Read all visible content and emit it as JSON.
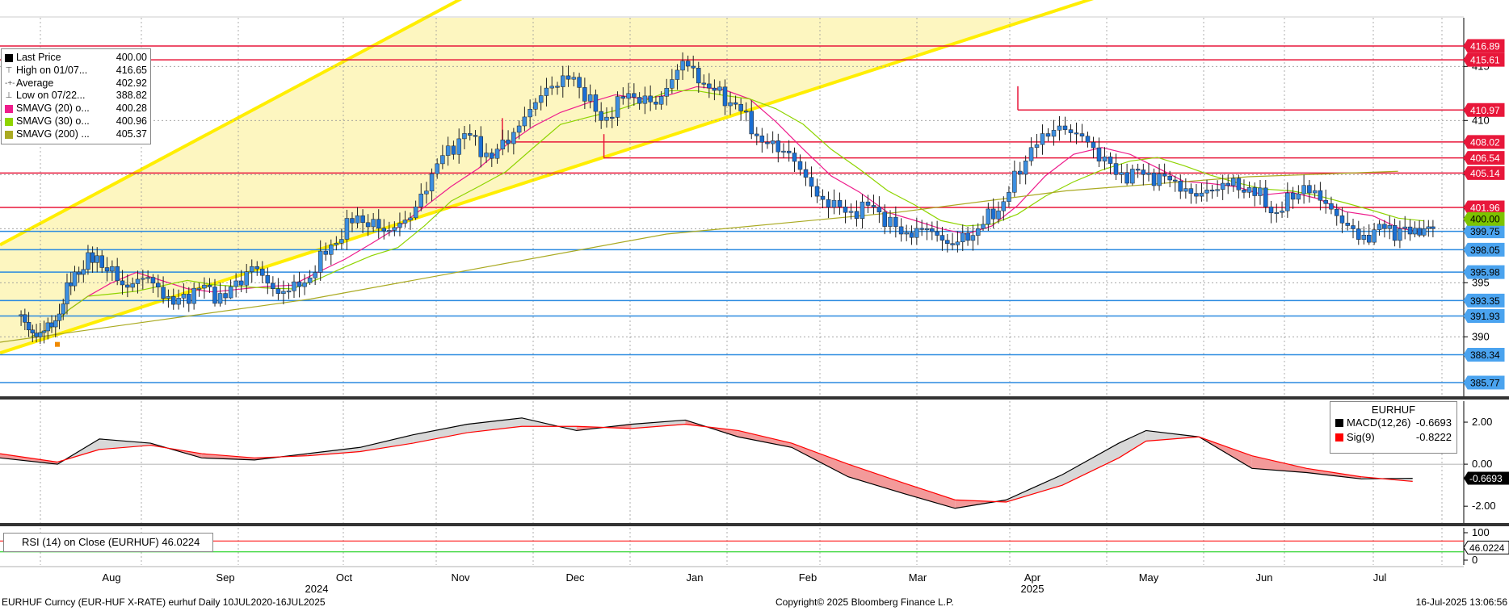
{
  "chart_data": {
    "type": "candlestick",
    "instrument": "EURHUF Curncy (EUR-HUF X-RATE) eurhuf",
    "period": "Daily 10JUL2020-16JUL2025",
    "months": [
      "Aug",
      "Sep",
      "Oct",
      "Nov",
      "Dec",
      "Jan",
      "Feb",
      "Mar",
      "Apr",
      "May",
      "Jun",
      "Jul"
    ],
    "years": [
      "2024",
      "2025"
    ],
    "price_ticks": [
      "415",
      "410",
      "405",
      "400",
      "395",
      "390"
    ],
    "ylim": [
      384.5,
      419.5
    ],
    "legend": {
      "items": [
        {
          "label": "Last Price",
          "value": "400.00",
          "color": "#000000",
          "icon": "square-swatch"
        },
        {
          "label": "High on 01/07...",
          "value": "416.65",
          "icon": "high-marker-icon"
        },
        {
          "label": "Average",
          "value": "402.92",
          "icon": "average-marker-icon"
        },
        {
          "label": "Low on 07/22...",
          "value": "388.82",
          "icon": "low-marker-icon"
        },
        {
          "label": "SMAVG (20)  o...",
          "value": "400.28",
          "color": "#ee1d8c"
        },
        {
          "label": "SMAVG (30)  o...",
          "value": "400.96",
          "color": "#8fd400"
        },
        {
          "label": "SMAVG (200)  ...",
          "value": "405.37",
          "color": "#aaaa22"
        }
      ]
    },
    "resistance_levels": [
      {
        "label": "416.89",
        "value": 416.89
      },
      {
        "label": "415.61",
        "value": 415.61
      },
      {
        "label": "410.97",
        "value": 410.97,
        "start_month": "Apr"
      },
      {
        "label": "408.02",
        "value": 408.02,
        "start_month": "Dec"
      },
      {
        "label": "406.54",
        "value": 406.54,
        "start_month": "Dec"
      },
      {
        "label": "405.14",
        "value": 405.14
      },
      {
        "label": "401.96",
        "value": 401.96
      }
    ],
    "support_levels": [
      {
        "label": "399.75",
        "value": 399.75
      },
      {
        "label": "398.05",
        "value": 398.05
      },
      {
        "label": "395.98",
        "value": 395.98
      },
      {
        "label": "393.35",
        "value": 393.35
      },
      {
        "label": "391.93",
        "value": 391.93
      },
      {
        "label": "388.34",
        "value": 388.34
      },
      {
        "label": "385.77",
        "value": 385.77
      }
    ],
    "last_price_tag": "400.00",
    "trend_channel": {
      "color": "#ffee00",
      "upper": [
        [
          "2024-07-01",
          398.5
        ],
        [
          "2024-12-30",
          431
        ]
      ],
      "lower": [
        [
          "2024-07-01",
          388.5
        ],
        [
          "2025-05-15",
          424
        ]
      ]
    },
    "candles_weekly_approx": [
      {
        "x": "2024-07-08",
        "o": 392.0,
        "h": 392.6,
        "l": 389.5,
        "c": 390.0
      },
      {
        "x": "2024-07-15",
        "o": 390.0,
        "h": 392.0,
        "l": 388.8,
        "c": 391.5
      },
      {
        "x": "2024-07-22",
        "o": 391.5,
        "h": 396.8,
        "l": 388.8,
        "c": 396.0
      },
      {
        "x": "2024-07-29",
        "o": 396.0,
        "h": 398.5,
        "l": 395.0,
        "c": 397.5
      },
      {
        "x": "2024-08-05",
        "o": 397.5,
        "h": 398.0,
        "l": 393.8,
        "c": 394.8
      },
      {
        "x": "2024-08-12",
        "o": 394.8,
        "h": 396.2,
        "l": 393.0,
        "c": 395.5
      },
      {
        "x": "2024-08-19",
        "o": 395.5,
        "h": 395.8,
        "l": 392.5,
        "c": 393.0
      },
      {
        "x": "2024-08-26",
        "o": 393.0,
        "h": 395.0,
        "l": 392.3,
        "c": 394.5
      },
      {
        "x": "2024-09-02",
        "o": 394.5,
        "h": 395.5,
        "l": 392.8,
        "c": 393.6
      },
      {
        "x": "2024-09-09",
        "o": 393.6,
        "h": 397.4,
        "l": 393.5,
        "c": 396.5
      },
      {
        "x": "2024-09-16",
        "o": 396.5,
        "h": 397.0,
        "l": 393.4,
        "c": 394.0
      },
      {
        "x": "2024-09-23",
        "o": 394.0,
        "h": 396.0,
        "l": 393.0,
        "c": 395.0
      },
      {
        "x": "2024-09-30",
        "o": 395.0,
        "h": 399.0,
        "l": 394.8,
        "c": 398.5
      },
      {
        "x": "2024-10-07",
        "o": 398.5,
        "h": 402.0,
        "l": 398.0,
        "c": 401.2
      },
      {
        "x": "2024-10-14",
        "o": 401.2,
        "h": 401.8,
        "l": 399.0,
        "c": 399.8
      },
      {
        "x": "2024-10-21",
        "o": 399.8,
        "h": 402.0,
        "l": 399.3,
        "c": 401.0
      },
      {
        "x": "2024-10-28",
        "o": 401.0,
        "h": 406.5,
        "l": 400.8,
        "c": 406.0
      },
      {
        "x": "2024-11-04",
        "o": 406.0,
        "h": 409.5,
        "l": 405.5,
        "c": 408.8
      },
      {
        "x": "2024-11-11",
        "o": 408.8,
        "h": 411.0,
        "l": 404.5,
        "c": 406.5
      },
      {
        "x": "2024-11-18",
        "o": 406.5,
        "h": 410.0,
        "l": 406.0,
        "c": 409.5
      },
      {
        "x": "2024-11-25",
        "o": 409.5,
        "h": 414.0,
        "l": 409.0,
        "c": 413.0
      },
      {
        "x": "2024-12-02",
        "o": 413.0,
        "h": 415.5,
        "l": 412.0,
        "c": 414.0
      },
      {
        "x": "2024-12-09",
        "o": 414.0,
        "h": 414.5,
        "l": 409.0,
        "c": 410.0
      },
      {
        "x": "2024-12-16",
        "o": 410.0,
        "h": 413.5,
        "l": 408.5,
        "c": 412.5
      },
      {
        "x": "2024-12-23",
        "o": 412.5,
        "h": 416.5,
        "l": 410.5,
        "c": 411.5
      },
      {
        "x": "2024-12-30",
        "o": 411.5,
        "h": 416.65,
        "l": 411.0,
        "c": 415.5
      },
      {
        "x": "2025-01-06",
        "o": 415.5,
        "h": 416.0,
        "l": 412.0,
        "c": 413.0
      },
      {
        "x": "2025-01-13",
        "o": 413.0,
        "h": 413.8,
        "l": 410.5,
        "c": 411.5
      },
      {
        "x": "2025-01-20",
        "o": 411.5,
        "h": 412.5,
        "l": 407.0,
        "c": 408.0
      },
      {
        "x": "2025-01-27",
        "o": 408.0,
        "h": 409.0,
        "l": 405.5,
        "c": 407.0
      },
      {
        "x": "2025-02-03",
        "o": 407.0,
        "h": 407.5,
        "l": 402.0,
        "c": 403.0
      },
      {
        "x": "2025-02-10",
        "o": 403.0,
        "h": 404.0,
        "l": 400.5,
        "c": 401.5
      },
      {
        "x": "2025-02-17",
        "o": 401.5,
        "h": 405.5,
        "l": 400.0,
        "c": 402.0
      },
      {
        "x": "2025-02-24",
        "o": 402.0,
        "h": 403.0,
        "l": 398.8,
        "c": 399.5
      },
      {
        "x": "2025-03-03",
        "o": 399.5,
        "h": 401.5,
        "l": 398.5,
        "c": 400.0
      },
      {
        "x": "2025-03-10",
        "o": 400.0,
        "h": 401.0,
        "l": 397.8,
        "c": 398.5
      },
      {
        "x": "2025-03-17",
        "o": 398.5,
        "h": 400.5,
        "l": 397.8,
        "c": 400.0
      },
      {
        "x": "2025-03-24",
        "o": 400.0,
        "h": 403.0,
        "l": 399.8,
        "c": 402.5
      },
      {
        "x": "2025-03-31",
        "o": 402.5,
        "h": 408.5,
        "l": 402.0,
        "c": 407.5
      },
      {
        "x": "2025-04-07",
        "o": 407.5,
        "h": 411.0,
        "l": 403.5,
        "c": 409.5
      },
      {
        "x": "2025-04-14",
        "o": 409.5,
        "h": 410.5,
        "l": 407.5,
        "c": 408.0
      },
      {
        "x": "2025-04-21",
        "o": 408.0,
        "h": 409.0,
        "l": 404.5,
        "c": 405.0
      },
      {
        "x": "2025-04-28",
        "o": 405.0,
        "h": 406.0,
        "l": 404.0,
        "c": 405.0
      },
      {
        "x": "2025-05-05",
        "o": 405.0,
        "h": 406.5,
        "l": 403.5,
        "c": 404.5
      },
      {
        "x": "2025-05-12",
        "o": 404.5,
        "h": 405.0,
        "l": 402.3,
        "c": 403.0
      },
      {
        "x": "2025-05-19",
        "o": 403.0,
        "h": 405.0,
        "l": 402.5,
        "c": 404.2
      },
      {
        "x": "2025-05-26",
        "o": 404.2,
        "h": 405.0,
        "l": 402.8,
        "c": 403.8
      },
      {
        "x": "2025-06-02",
        "o": 403.8,
        "h": 404.5,
        "l": 400.5,
        "c": 401.5
      },
      {
        "x": "2025-06-09",
        "o": 401.5,
        "h": 405.0,
        "l": 401.0,
        "c": 404.0
      },
      {
        "x": "2025-06-16",
        "o": 404.0,
        "h": 404.5,
        "l": 401.0,
        "c": 401.8
      },
      {
        "x": "2025-06-23",
        "o": 401.8,
        "h": 402.3,
        "l": 398.5,
        "c": 399.0
      },
      {
        "x": "2025-06-30",
        "o": 399.0,
        "h": 400.8,
        "l": 398.5,
        "c": 400.0
      },
      {
        "x": "2025-07-07",
        "o": 400.0,
        "h": 401.2,
        "l": 398.2,
        "c": 399.5
      },
      {
        "x": "2025-07-14",
        "o": 399.5,
        "h": 400.8,
        "l": 399.2,
        "c": 400.0
      }
    ],
    "macd": {
      "label": "MACD(12,26)",
      "value": "-0.6693",
      "color": "#000000",
      "signal_label": "Sig(9)",
      "signal_value": "-0.8222",
      "signal_color": "#ff0000",
      "panel_title": "EURHUF",
      "ticks": [
        "2.00",
        "0.00",
        "-2.00"
      ],
      "last_tag": "-0.6693",
      "ylim": [
        -2.8,
        3.0
      ],
      "points": [
        [
          "2024-07-01",
          0.3
        ],
        [
          "2024-07-22",
          0.0
        ],
        [
          "2024-08-05",
          1.2
        ],
        [
          "2024-08-19",
          1.0
        ],
        [
          "2024-09-02",
          0.3
        ],
        [
          "2024-09-16",
          0.2
        ],
        [
          "2024-09-30",
          0.5
        ],
        [
          "2024-10-14",
          0.8
        ],
        [
          "2024-10-28",
          1.4
        ],
        [
          "2024-11-11",
          1.9
        ],
        [
          "2024-11-25",
          2.2
        ],
        [
          "2024-12-09",
          1.6
        ],
        [
          "2024-12-23",
          1.9
        ],
        [
          "2025-01-06",
          2.1
        ],
        [
          "2025-01-20",
          1.3
        ],
        [
          "2025-02-03",
          0.8
        ],
        [
          "2025-02-17",
          -0.6
        ],
        [
          "2025-03-03",
          -1.4
        ],
        [
          "2025-03-17",
          -2.1
        ],
        [
          "2025-03-31",
          -1.7
        ],
        [
          "2025-04-14",
          -0.5
        ],
        [
          "2025-04-28",
          1.0
        ],
        [
          "2025-05-05",
          1.6
        ],
        [
          "2025-05-19",
          1.3
        ],
        [
          "2025-06-02",
          -0.2
        ],
        [
          "2025-06-16",
          -0.4
        ],
        [
          "2025-06-30",
          -0.7
        ],
        [
          "2025-07-14",
          -0.67
        ]
      ],
      "signal": [
        [
          "2024-07-01",
          0.5
        ],
        [
          "2024-07-22",
          0.1
        ],
        [
          "2024-08-05",
          0.7
        ],
        [
          "2024-08-19",
          0.9
        ],
        [
          "2024-09-02",
          0.5
        ],
        [
          "2024-09-16",
          0.3
        ],
        [
          "2024-09-30",
          0.4
        ],
        [
          "2024-10-14",
          0.6
        ],
        [
          "2024-10-28",
          1.0
        ],
        [
          "2024-11-11",
          1.5
        ],
        [
          "2024-11-25",
          1.8
        ],
        [
          "2024-12-09",
          1.8
        ],
        [
          "2024-12-23",
          1.7
        ],
        [
          "2025-01-06",
          1.9
        ],
        [
          "2025-01-20",
          1.6
        ],
        [
          "2025-02-03",
          1.0
        ],
        [
          "2025-02-17",
          0.0
        ],
        [
          "2025-03-03",
          -0.9
        ],
        [
          "2025-03-17",
          -1.7
        ],
        [
          "2025-03-31",
          -1.8
        ],
        [
          "2025-04-14",
          -1.0
        ],
        [
          "2025-04-28",
          0.3
        ],
        [
          "2025-05-05",
          1.1
        ],
        [
          "2025-05-19",
          1.3
        ],
        [
          "2025-06-02",
          0.4
        ],
        [
          "2025-06-16",
          -0.2
        ],
        [
          "2025-06-30",
          -0.6
        ],
        [
          "2025-07-14",
          -0.82
        ]
      ]
    },
    "rsi": {
      "label": "RSI (14)  on Close (EURHUF)",
      "value": "46.0224",
      "ticks": [
        "100",
        "0"
      ],
      "last_tag": "46.0224",
      "overbought_color": "#ff0000",
      "oversold_color": "#00cc00"
    }
  },
  "footer": {
    "left": "EURHUF Curncy (EUR-HUF X-RATE) eurhuf  Daily 10JUL2020-16JUL2025",
    "center": "Copyright© 2025 Bloomberg Finance L.P.",
    "right": "16-Jul-2025 13:06:56"
  },
  "colors": {
    "candle_up": "#3d8fe0",
    "candle_down": "#1b6fd3",
    "resistance": "#e8173a",
    "support": "#2a8ae0",
    "channel_fill": "#fdf6c0",
    "grid": "#999999"
  }
}
